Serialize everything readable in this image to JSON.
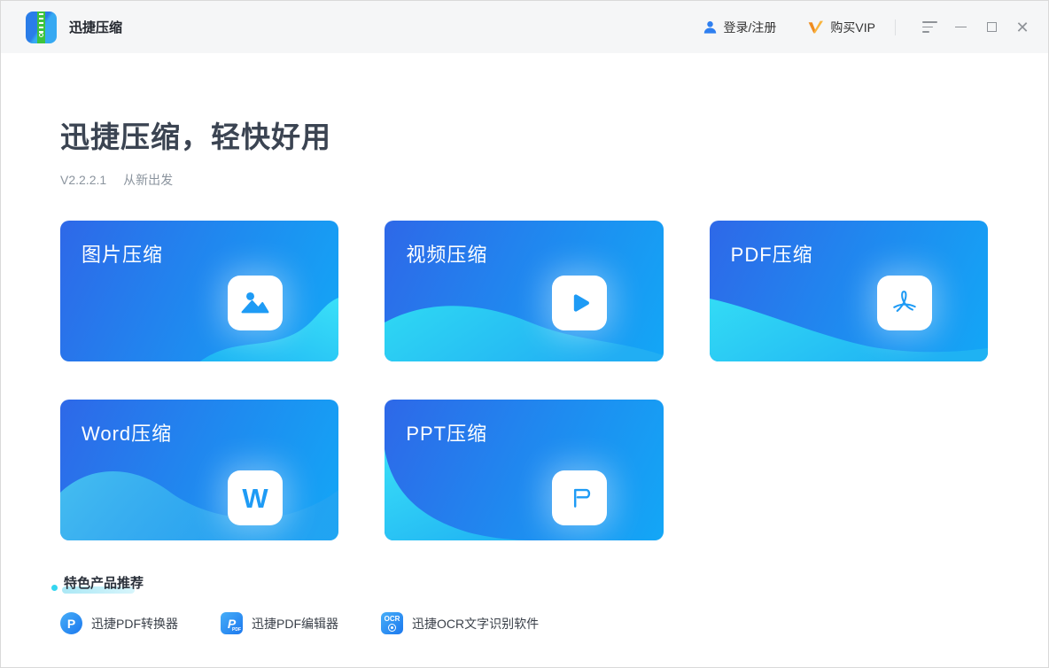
{
  "window": {
    "title": "迅捷压缩"
  },
  "titlebar": {
    "login_label": "登录/注册",
    "vip_label": "购买VIP"
  },
  "hero": {
    "title": "迅捷压缩，轻快好用",
    "version": "V2.2.2.1",
    "slogan": "从新出发"
  },
  "cards": [
    {
      "label": "图片压缩",
      "icon": "image-icon"
    },
    {
      "label": "视频压缩",
      "icon": "play-icon"
    },
    {
      "label": "PDF压缩",
      "icon": "pdf-icon"
    },
    {
      "label": "Word压缩",
      "icon": "word-icon",
      "glyph": "W"
    },
    {
      "label": "PPT压缩",
      "icon": "ppt-icon"
    }
  ],
  "featured": {
    "heading": "特色产品推荐",
    "products": [
      {
        "label": "迅捷PDF转换器",
        "icon": "pdf-converter-icon",
        "glyph": "P"
      },
      {
        "label": "迅捷PDF编辑器",
        "icon": "pdf-editor-icon",
        "glyph": "P",
        "badge": "PDF"
      },
      {
        "label": "迅捷OCR文字识别软件",
        "icon": "ocr-icon",
        "glyph": "OCR"
      }
    ]
  },
  "colors": {
    "accent_blue": "#2196f3",
    "card_gradient_start": "#2e68e8",
    "card_gradient_end": "#13a7f6",
    "wave_cyan": "#35d6f0",
    "vip_orange": "#f7a528",
    "titlebar_bg": "#f5f6f7"
  }
}
